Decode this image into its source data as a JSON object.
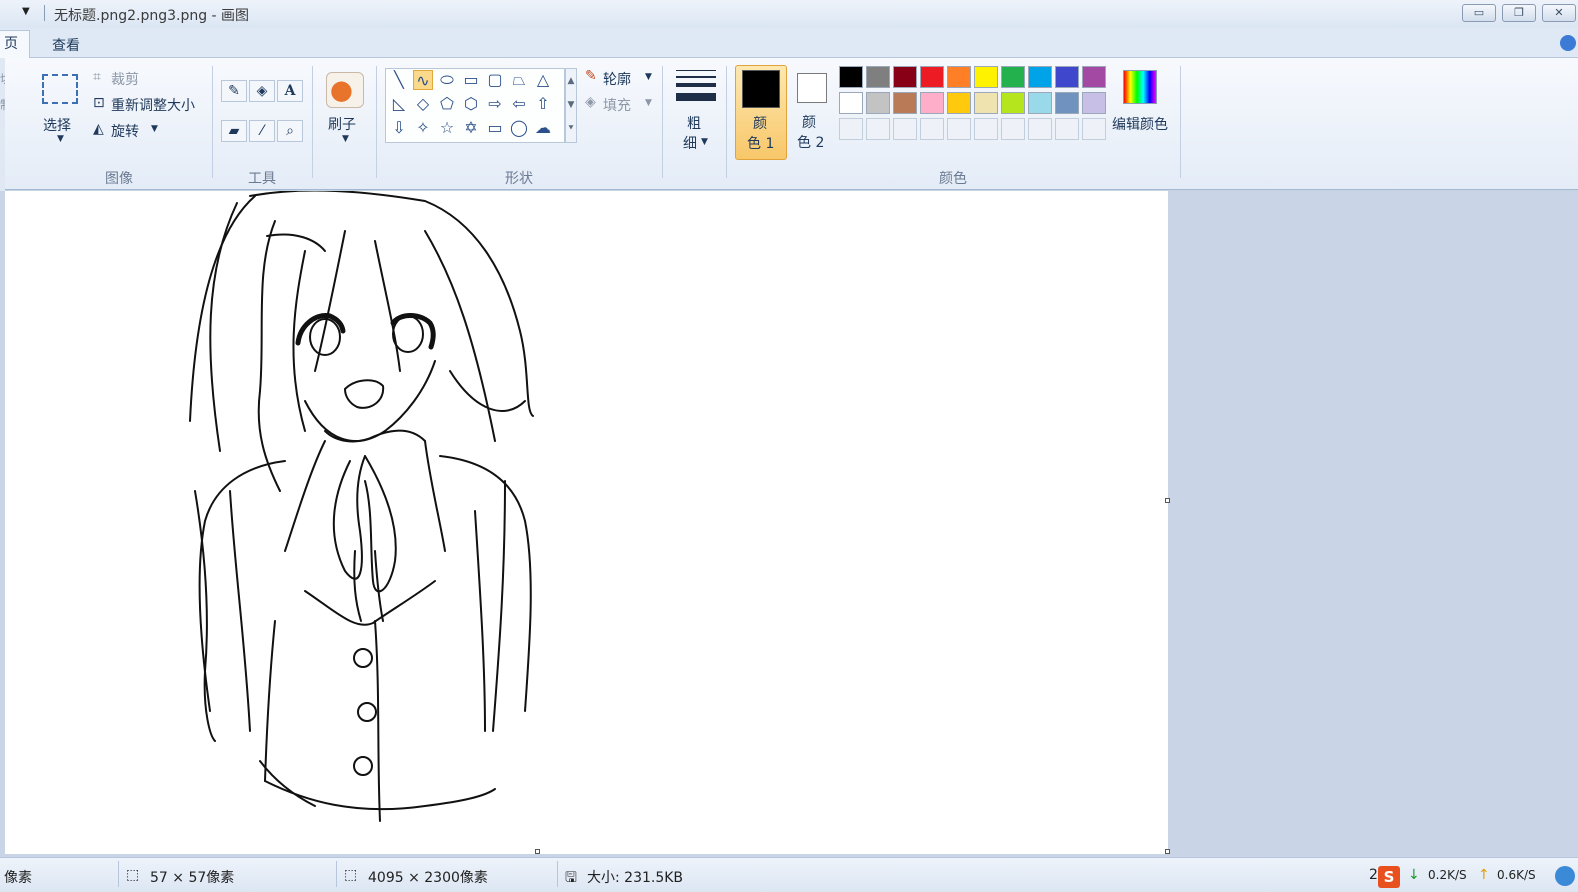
{
  "window": {
    "title": "无标题.png2.png3.png - 画图",
    "min_label": "▭",
    "restore_label": "❐",
    "close_label": "✕"
  },
  "tabs": {
    "home": "页",
    "view": "查看"
  },
  "clipboard": {
    "cut_partial": "切",
    "copy_partial": "制"
  },
  "image_group": {
    "label": "图像",
    "select": "选择",
    "crop": "裁剪",
    "resize": "重新调整大小",
    "rotate": "旋转"
  },
  "tools_group": {
    "label": "工具"
  },
  "brush": {
    "label": "刷子"
  },
  "shapes_group": {
    "label": "形状",
    "outline": "轮廓",
    "fill": "填充",
    "shape_icons": [
      "line-icon",
      "curve-icon",
      "oval-icon",
      "rectangle-icon",
      "rounded-rectangle-icon",
      "polygon-icon",
      "triangle-icon",
      "right-triangle-icon",
      "diamond-icon",
      "pentagon-icon",
      "hexagon-icon",
      "right-arrow-icon",
      "left-arrow-icon",
      "up-arrow-icon",
      "down-arrow-icon",
      "four-point-star-icon",
      "five-point-star-icon",
      "six-point-star-icon",
      "rounded-callout-icon",
      "oval-callout-icon",
      "cloud-callout-icon"
    ]
  },
  "size": {
    "line1": "粗",
    "line2": "细"
  },
  "colors_group": {
    "label": "颜色",
    "color1_line1": "颜",
    "color1_line2": "色 1",
    "color2_line1": "颜",
    "color2_line2": "色 2",
    "edit_colors": "编辑颜色",
    "color1": "#000000",
    "color2": "#ffffff",
    "palette_row1": [
      "#000000",
      "#7f7f7f",
      "#880015",
      "#ed1c24",
      "#ff7f27",
      "#fff200",
      "#22b14c",
      "#00a2e8",
      "#3f48cc",
      "#a349a4"
    ],
    "palette_row2": [
      "#ffffff",
      "#c3c3c3",
      "#b97a57",
      "#ffaec9",
      "#ffc90e",
      "#efe4b0",
      "#b5e61d",
      "#99d9ea",
      "#7092be",
      "#c8bfe7"
    ]
  },
  "status": {
    "position_partial": "像素",
    "selection": "57 × 57像素",
    "image_size": "4095 × 2300像素",
    "file_size": "大小: 231.5KB",
    "zoom_partial": "2",
    "down_speed": "0.2K/S",
    "up_speed": "0.6K/S"
  }
}
